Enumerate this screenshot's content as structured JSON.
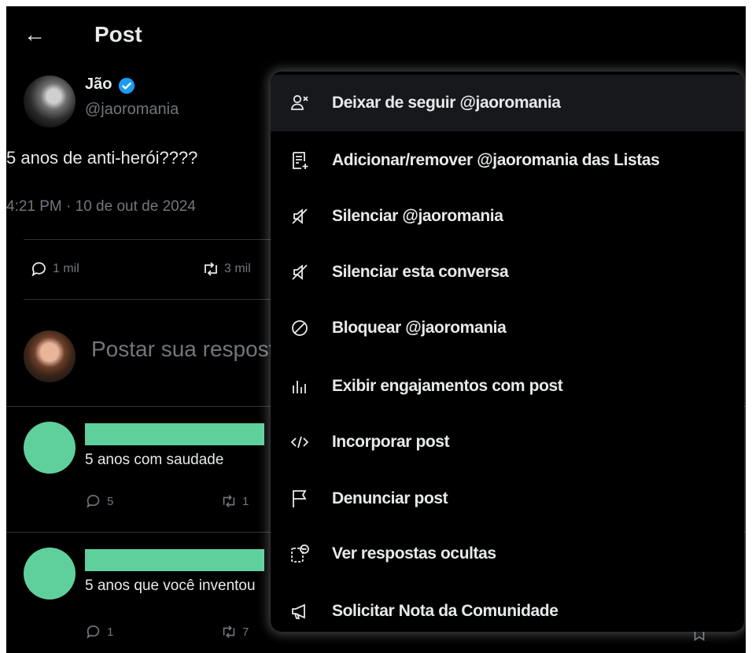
{
  "header": {
    "title": "Post"
  },
  "author": {
    "name": "Jão",
    "handle": "@jaoromania"
  },
  "post": {
    "text": "5 anos de anti-herói????",
    "time": "4:21 PM · 10 de out de 2024",
    "stats": {
      "replies": "1 mil",
      "reposts": "3 mil"
    }
  },
  "reply_box": {
    "placeholder": "Postar sua resposta"
  },
  "replies": [
    {
      "text": "5 anos com saudade",
      "reply_count": "5",
      "repost_count": "1"
    },
    {
      "text": "5 anos que você inventou",
      "reply_count": "1",
      "repost_count": "7"
    }
  ],
  "menu": {
    "items": [
      {
        "label": "Deixar de seguir @jaoromania",
        "icon": "unfollow-icon"
      },
      {
        "label": "Adicionar/remover @jaoromania das Listas",
        "icon": "list-add-icon"
      },
      {
        "label": "Silenciar @jaoromania",
        "icon": "mute-icon"
      },
      {
        "label": "Silenciar esta conversa",
        "icon": "mute-icon"
      },
      {
        "label": "Bloquear @jaoromania",
        "icon": "block-icon"
      },
      {
        "label": "Exibir engajamentos com post",
        "icon": "engagement-icon"
      },
      {
        "label": "Incorporar post",
        "icon": "embed-icon"
      },
      {
        "label": "Denunciar post",
        "icon": "flag-icon"
      },
      {
        "label": "Ver respostas ocultas",
        "icon": "hidden-replies-icon"
      },
      {
        "label": "Solicitar Nota da Comunidade",
        "icon": "megaphone-icon"
      }
    ]
  },
  "colors": {
    "background": "#000000",
    "accent": "#1d9bf0",
    "redaction": "#5fd09c",
    "muted": "#71767b"
  }
}
